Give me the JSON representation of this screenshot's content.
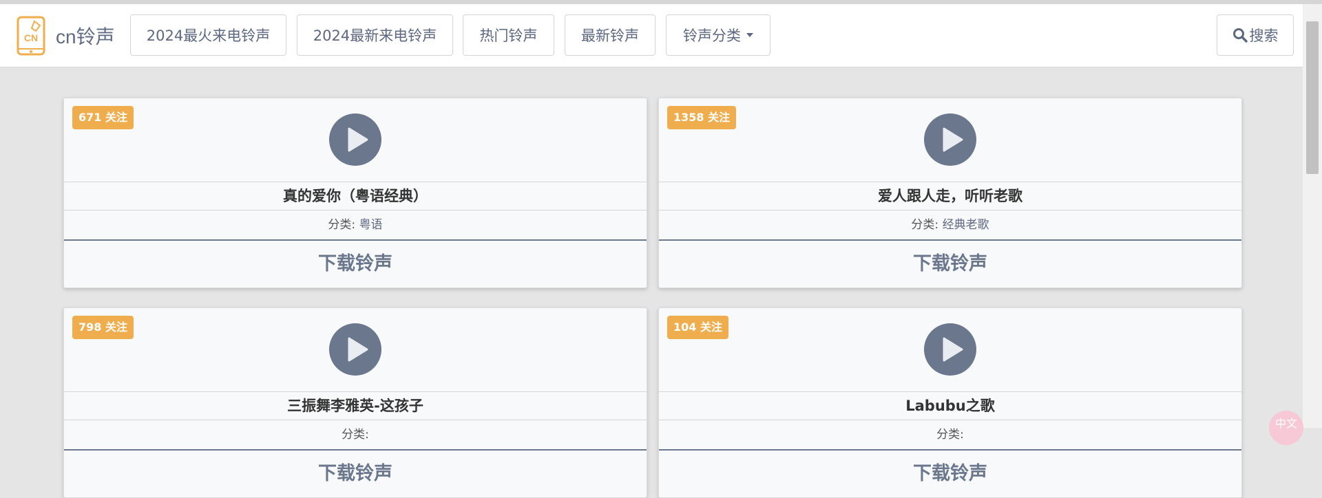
{
  "brand": {
    "name": "cn铃声",
    "logo_text": "CN"
  },
  "nav": {
    "items": [
      "2024最火来电铃声",
      "2024最新来电铃声",
      "热门铃声",
      "最新铃声",
      "铃声分类"
    ],
    "search_label": "搜索"
  },
  "cards": [
    {
      "badge": "671 关注",
      "title": "真的爱你（粤语经典）",
      "category_label": "分类:",
      "category": "粤语",
      "download": "下载铃声"
    },
    {
      "badge": "1358 关注",
      "title": "爱人跟人走，听听老歌",
      "category_label": "分类:",
      "category": "经典老歌",
      "download": "下载铃声"
    },
    {
      "badge": "798 关注",
      "title": "三振舞李雅英-这孩子",
      "category_label": "分类:",
      "category": "",
      "download": "下载铃声"
    },
    {
      "badge": "104 关注",
      "title": "Labubu之歌",
      "category_label": "分类:",
      "category": "",
      "download": "下载铃声"
    }
  ],
  "float_button": {
    "label": "中文"
  },
  "colors": {
    "accent": "#f0ad4e",
    "play": "#6b778c",
    "nav_text": "#5c6780"
  },
  "icons": [
    "phone-logo-icon",
    "caret-down-icon",
    "search-icon",
    "play-icon"
  ]
}
